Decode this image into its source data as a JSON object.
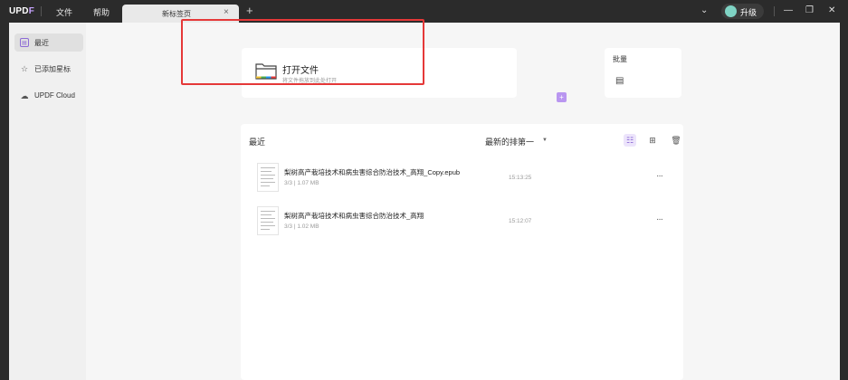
{
  "titlebar": {
    "logo_prefix": "UPD",
    "logo_suffix": "F",
    "menu": [
      "文件",
      "帮助"
    ],
    "tab_title": "新标签页",
    "tab_close": "×",
    "tab_add": "+",
    "upgrade_label": "升级",
    "avatar_letter": "",
    "dropdown_glyph": "⌄",
    "minimize_glyph": "—",
    "restore_glyph": "❐",
    "close_glyph": "✕"
  },
  "sidebar": {
    "items": [
      {
        "label": "最近",
        "icon": "recent-icon",
        "active": true
      },
      {
        "label": "已添加星标",
        "icon": "star-icon",
        "active": false
      },
      {
        "label": "UPDF Cloud",
        "icon": "cloud-icon",
        "active": false
      }
    ]
  },
  "open_card": {
    "title": "打开文件",
    "subtitle": "将文件拖放到此处打开",
    "plus": "+"
  },
  "batch_card": {
    "label": "批量",
    "icon": "batch-icon"
  },
  "recent": {
    "title": "最近",
    "sort_label": "最新的排第一",
    "sort_caret": "▼",
    "files": [
      {
        "name": "梨树高产栽培技术和病虫害综合防治技术_高翔_Copy.epub",
        "meta": "3/3  |  1.07 MB",
        "time": "15:13:25",
        "more": "···"
      },
      {
        "name": "梨树高产栽培技术和病虫害综合防治技术_高翔",
        "meta": "3/3  |  1.02 MB",
        "time": "15:12:07",
        "more": "···"
      }
    ]
  },
  "colors": {
    "accent": "#8d6bd6",
    "highlight": "#e53838",
    "titlebar": "#2b2b2b"
  }
}
